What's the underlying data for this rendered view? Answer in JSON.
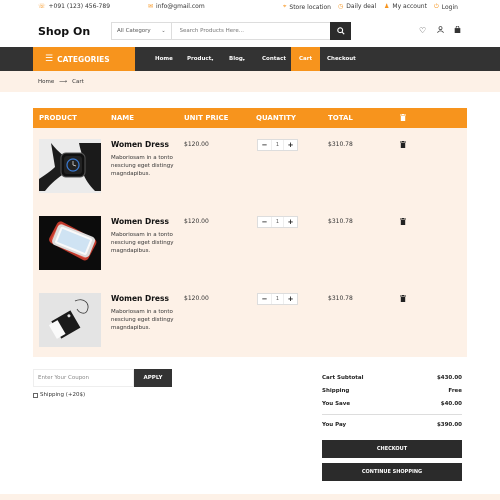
{
  "topbar": {
    "phone": "+091 (123) 456-789",
    "email": "info@gmail.com",
    "store_location": "Store location",
    "daily_deal": "Daily deal",
    "my_account": "My account",
    "login": "Login"
  },
  "header": {
    "logo": "Shop On",
    "category_select": "All Category",
    "search_placeholder": "Search Products Here..."
  },
  "nav": {
    "categories_label": "CATEGORIES",
    "items": [
      "Home",
      "Product",
      "Blog",
      "Contact",
      "Cart",
      "Checkout"
    ],
    "active": "Cart"
  },
  "breadcrumb": {
    "home": "Home",
    "current": "Cart"
  },
  "cart_table": {
    "headers": {
      "product": "PRODUCT",
      "name": "NAME",
      "unit_price": "UNIT PRICE",
      "quantity": "QUANTITY",
      "total": "TOTAL"
    },
    "rows": [
      {
        "name": "Women Dress",
        "description": "Maboriosam in a tonto nesciung eget distingy magndapibus.",
        "unit_price": "$120.00",
        "quantity": "1",
        "total": "$310.78"
      },
      {
        "name": "Women Dress",
        "description": "Maboriosam in a tonto nesciung eget distingy magndapibus.",
        "unit_price": "$120.00",
        "quantity": "1",
        "total": "$310.78"
      },
      {
        "name": "Women Dress",
        "description": "Maboriosam in a tonto nesciung eget distingy magndapibus.",
        "unit_price": "$120.00",
        "quantity": "1",
        "total": "$310.78"
      }
    ]
  },
  "coupon": {
    "placeholder": "Enter Your Coupon",
    "apply_label": "APPLY",
    "shipping_option": "Shipping (+20$)"
  },
  "summary": {
    "subtotal_label": "Cart Subtotal",
    "subtotal_value": "$430.00",
    "shipping_label": "Shipping",
    "shipping_value": "Free",
    "save_label": "You Save",
    "save_value": "$40.00",
    "pay_label": "You Pay",
    "pay_value": "$390.00",
    "checkout_label": "CHECKOUT",
    "continue_label": "CONTINUE SHOPPING"
  },
  "colors": {
    "accent": "#f7941d",
    "dark": "#333333",
    "light_bg": "#fdf1e7"
  }
}
